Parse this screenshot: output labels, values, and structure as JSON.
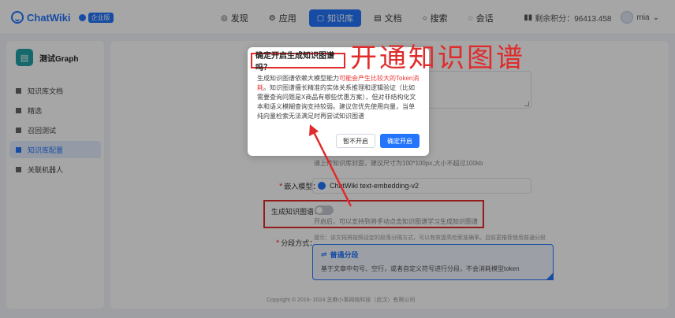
{
  "header": {
    "logo_text": "ChatWiki",
    "badge": "企业版",
    "nav": [
      {
        "label": "发现",
        "icon": "compass-icon"
      },
      {
        "label": "应用",
        "icon": "app-icon"
      },
      {
        "label": "知识库",
        "icon": "book-icon",
        "active": true
      },
      {
        "label": "文档",
        "icon": "doc-icon"
      },
      {
        "label": "搜索",
        "icon": "search-icon"
      },
      {
        "label": "会话",
        "icon": "chat-icon"
      }
    ],
    "credits": "剩余积分：96413.458",
    "user": "mia"
  },
  "sidebar": {
    "kb_name": "测试Graph",
    "items": [
      {
        "label": "知识库文档"
      },
      {
        "label": "精选"
      },
      {
        "label": "召回测试"
      },
      {
        "label": "知识库配置",
        "active": true
      },
      {
        "label": "关联机器人"
      }
    ]
  },
  "form": {
    "upload_hint": "请上传知识库封面，建议尺寸为100*100px,大小不超过100kb",
    "embed_label": "嵌入模型：",
    "embed_value": "ChatWiki text-embedding-v2",
    "graph_label": "生成知识图谱：",
    "graph_hint": "开启后，可以支持到将手动点击知识图谱学习生成知识图谱",
    "seg_label": "分段方式：",
    "seg_hint": "提示：该文档将按照设定的段落分隔方式，可以有效提高检索准确率。目前更推荐使用普通分段",
    "seg_title": "普通分段",
    "seg_desc": "基于文章中句号、空行，或者自定义符号进行分段，不会消耗模型token"
  },
  "copyright": "Copyright © 2016- 2024 芝麻小事网络科技（武汉）有限公司",
  "dialog": {
    "title": "确定开启生成知识图谱吗？",
    "body_1": "生成知识图谱依赖大模型能力",
    "body_warn": "可能会产生比较大的Token消耗",
    "body_2": "。知识图谱擅长精准的实体关系推理和逻辑验证（比如需要查询问题是X商品有哪些优惠方案），但对非结构化文本和语义模糊查询支持较弱。建议您优先使用向量，当单纯向量检索无法满足时再尝试知识图谱",
    "cancel": "暂不开启",
    "confirm": "确定开启"
  },
  "annotation": "开通知识图谱",
  "colors": {
    "accent": "#2475fc",
    "annotation_red": "#e02b2b"
  }
}
